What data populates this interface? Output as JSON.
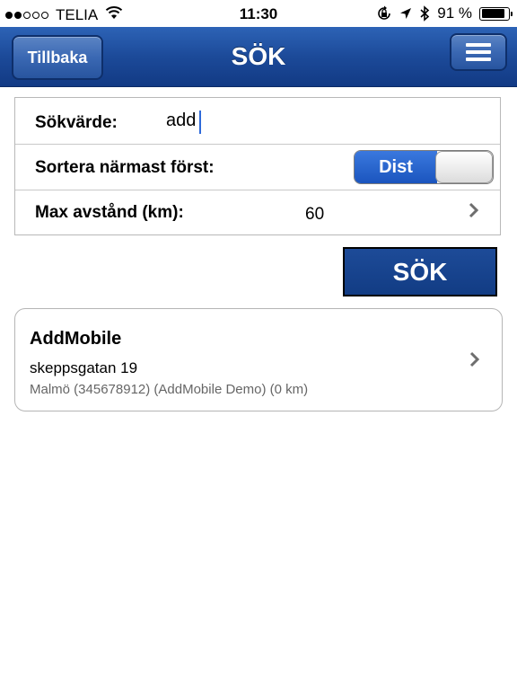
{
  "status_bar": {
    "carrier": "TELIA",
    "time": "11:30",
    "battery_percent": "91 %",
    "battery_level": 0.91,
    "icons": [
      "signal-dots-icon",
      "wifi-icon",
      "rotation-lock-icon",
      "location-arrow-icon",
      "bluetooth-icon",
      "battery-icon"
    ]
  },
  "navbar": {
    "title": "SÖK",
    "back_label": "Tillbaka",
    "menu_icon": "hamburger-menu-icon"
  },
  "form": {
    "search": {
      "label": "Sökvärde:",
      "value": "add",
      "placeholder": ""
    },
    "sort": {
      "label": "Sortera närmast först:",
      "toggle_label": "Dist",
      "toggle_on": true
    },
    "max_distance": {
      "label": "Max avstånd (km):",
      "value": "60",
      "chevron_icon": "chevron-right-icon"
    }
  },
  "search_button": {
    "label": "SÖK"
  },
  "results": [
    {
      "name": "AddMobile",
      "address": "skeppsgatan 19",
      "detail": "Malmö (345678912) (AddMobile Demo) (0 km)",
      "chevron_icon": "chevron-right-icon"
    }
  ],
  "colors": {
    "navbar_blue": "#1c4a99",
    "toggle_blue": "#1b55be",
    "button_blue": "#123c84",
    "caret_blue": "#2f6ad9"
  }
}
